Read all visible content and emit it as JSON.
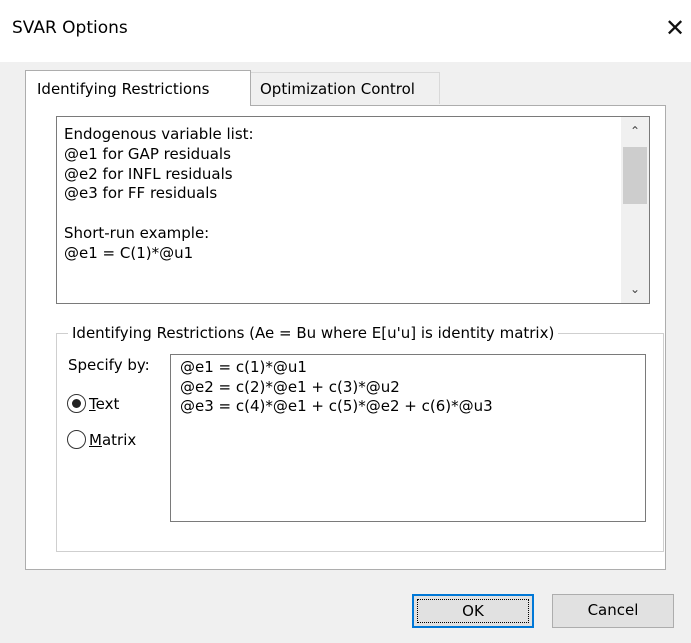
{
  "window": {
    "title": "SVAR Options",
    "close_glyph": "✕"
  },
  "tabs": [
    {
      "label": "Identifying Restrictions",
      "active": true
    },
    {
      "label": "Optimization Control",
      "active": false
    }
  ],
  "info_text": {
    "lines": [
      "Endogenous variable list:",
      "@e1 for GAP residuals",
      "@e2 for INFL residuals",
      "@e3 for FF residuals",
      "",
      "Short-run example:",
      "@e1 = C(1)*@u1"
    ]
  },
  "restrictions_group": {
    "legend": "Identifying Restrictions  (Ae = Bu where E[u'u] is identity matrix)",
    "specify_label": "Specify by:",
    "options": [
      {
        "label": "Text",
        "selected": true
      },
      {
        "label": "Matrix",
        "selected": false
      }
    ],
    "text_lines": [
      "@e1 = c(1)*@u1",
      "@e2 = c(2)*@e1 + c(3)*@u2",
      "@e3 = c(4)*@e1 + c(5)*@e2 + c(6)*@u3"
    ]
  },
  "buttons": {
    "ok": "OK",
    "cancel": "Cancel"
  }
}
